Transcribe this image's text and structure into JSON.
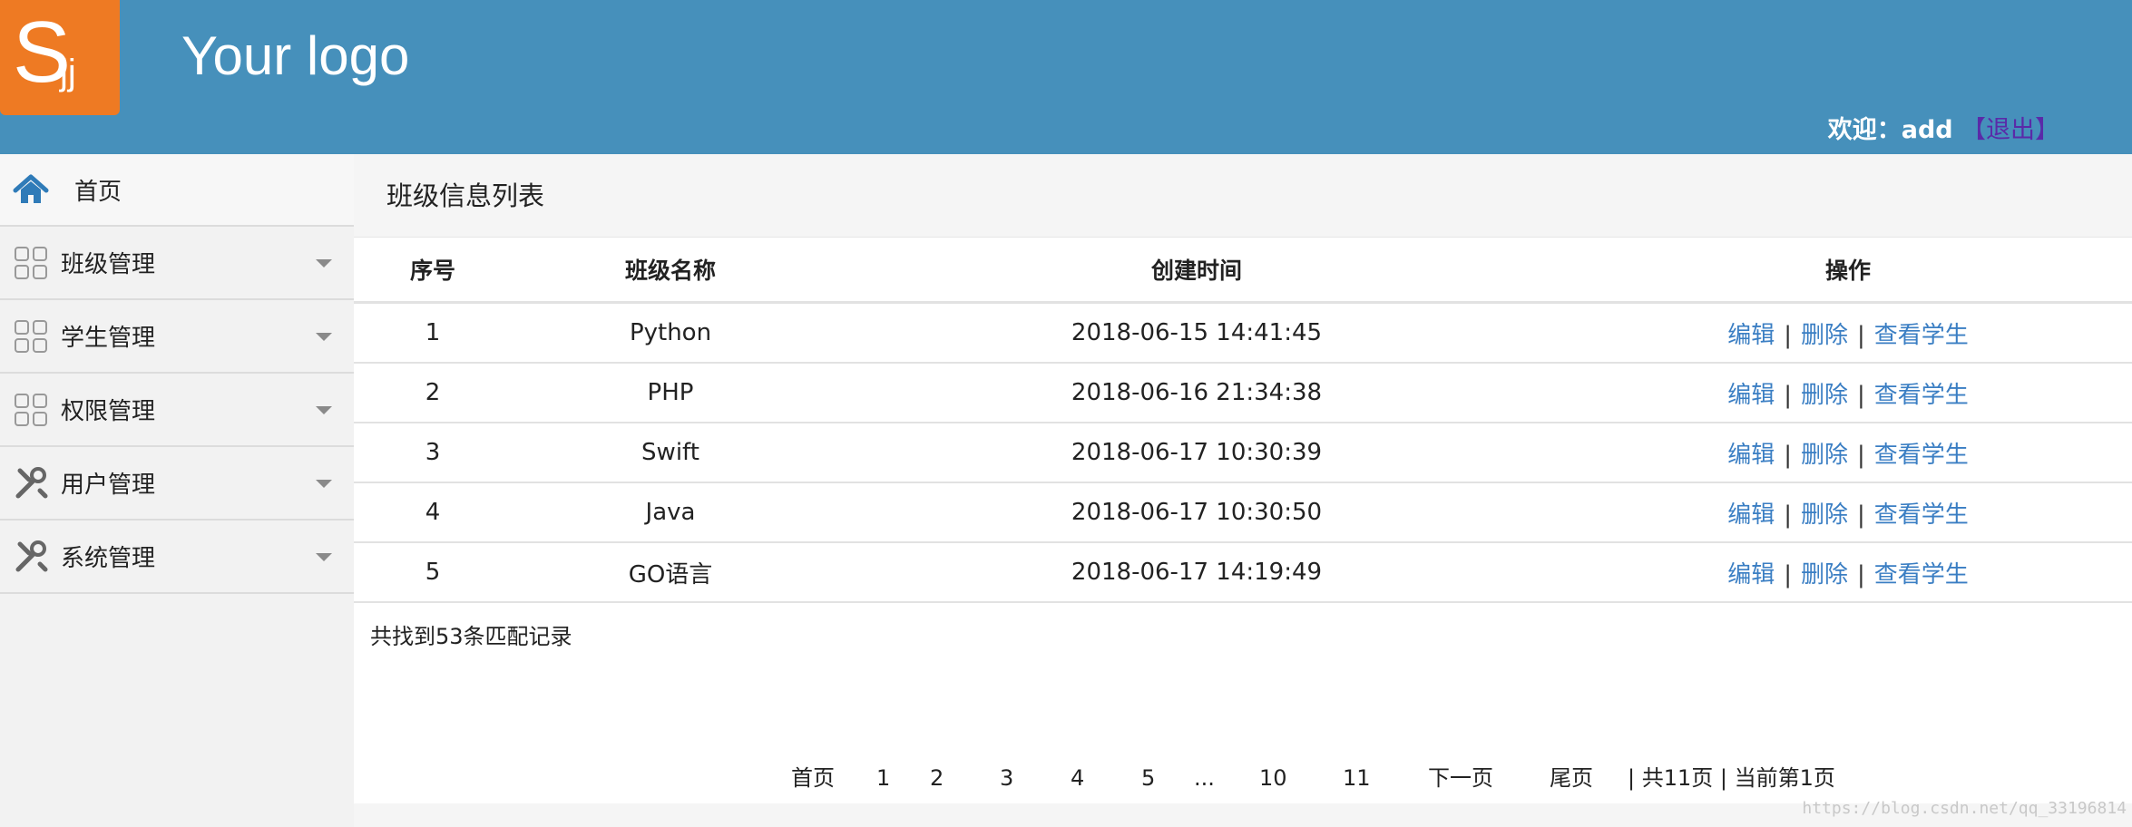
{
  "header": {
    "logo_letter": "S",
    "logo_sub": "jj",
    "logo_text": "Your logo",
    "welcome_text": "欢迎：add ",
    "logout_label": "【退出】",
    "background_color": "#4690bb",
    "logo_color": "#ee7a23"
  },
  "sidebar": {
    "items": [
      {
        "label": "首页",
        "icon": "home-icon"
      },
      {
        "label": "班级管理",
        "icon": "grid-icon"
      },
      {
        "label": "学生管理",
        "icon": "grid-icon"
      },
      {
        "label": "权限管理",
        "icon": "grid-icon"
      },
      {
        "label": "用户管理",
        "icon": "tools-icon"
      },
      {
        "label": "系统管理",
        "icon": "tools-icon"
      }
    ]
  },
  "main": {
    "title": "班级信息列表",
    "table": {
      "headers": [
        "序号",
        "班级名称",
        "创建时间",
        "操作"
      ],
      "rows": [
        {
          "id": "1",
          "name": "Python",
          "created": "2018-06-15 14:41:45"
        },
        {
          "id": "2",
          "name": "PHP",
          "created": "2018-06-16 21:34:38"
        },
        {
          "id": "3",
          "name": "Swift",
          "created": "2018-06-17 10:30:39"
        },
        {
          "id": "4",
          "name": "Java",
          "created": "2018-06-17 10:30:50"
        },
        {
          "id": "5",
          "name": "GO语言",
          "created": "2018-06-17 14:19:49"
        }
      ],
      "actions": {
        "edit": "编辑",
        "delete": "删除",
        "view_students": "查看学生",
        "separator": "|"
      }
    },
    "total_text": "共找到53条匹配记录",
    "pagination": {
      "first": "首页",
      "pages": [
        "1",
        "2",
        "3",
        "4",
        "5",
        "...",
        "10",
        "11"
      ],
      "next": "下一页",
      "last": "尾页",
      "summary": "| 共11页 | 当前第1页"
    },
    "link_color": "#3a7ec3"
  },
  "watermark": "https://blog.csdn.net/qq_33196814"
}
